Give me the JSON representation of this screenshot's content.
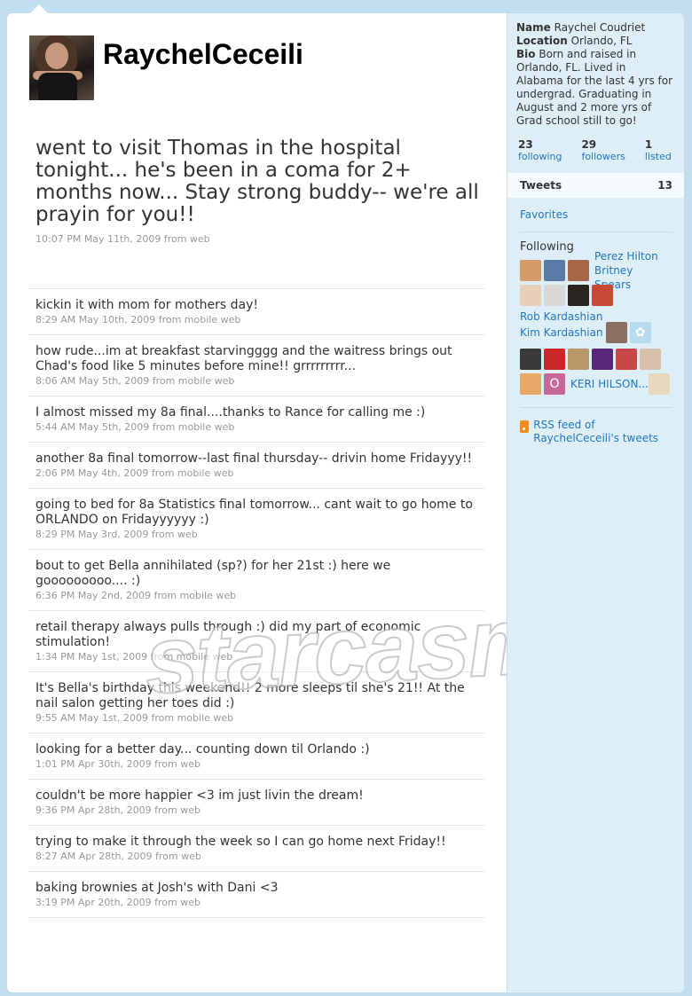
{
  "profile": {
    "username": "RaychelCeceili",
    "name_label": "Name",
    "name": "Raychel Coudriet",
    "location_label": "Location",
    "location": "Orlando, FL",
    "bio_label": "Bio",
    "bio": "Born and raised in Orlando, FL. Lived in Alabama for the last 4 yrs for undergrad. Graduating in August and 2 more yrs of Grad school still to go!"
  },
  "stats": [
    {
      "num": "23",
      "label": "following"
    },
    {
      "num": "29",
      "label": "followers"
    },
    {
      "num": "1",
      "label": "listed"
    }
  ],
  "sidebar": {
    "tweets_label": "Tweets",
    "tweets_count": "13",
    "favorites_label": "Favorites",
    "following_heading": "Following",
    "following_names": {
      "perez": "Perez Hilton",
      "britney": "Britney Spears",
      "rob": "Rob Kardashian",
      "kim": "Kim Kardashian",
      "keri": "KERI HILSON..."
    },
    "rss_label": "RSS feed of RaychelCeceili's tweets"
  },
  "featured": {
    "text": "went to visit Thomas in the hospital tonight... he's been in a coma for 2+ months now... Stay strong buddy-- we're all prayin for you!!",
    "meta": "10:07 PM May 11th, 2009 from web"
  },
  "tweets": [
    {
      "text": "kickin it with mom for mothers day!",
      "meta": "8:29 AM May 10th, 2009 from mobile web"
    },
    {
      "text": "how rude...im at breakfast starvingggg and the waitress brings out Chad's food like 5 minutes before mine!! grrrrrrrrr...",
      "meta": "8:06 AM May 5th, 2009 from mobile web"
    },
    {
      "text": "I almost missed my 8a final....thanks to Rance for calling me :)",
      "meta": "5:44 AM May 5th, 2009 from mobile web"
    },
    {
      "text": "another 8a final tomorrow--last final thursday-- drivin home Fridayyy!!",
      "meta": "2:06 PM May 4th, 2009 from mobile web"
    },
    {
      "text": "going to bed for 8a Statistics final tomorrow... cant wait to go home to ORLANDO on Fridayyyyyy :)",
      "meta": "8:29 PM May 3rd, 2009 from web"
    },
    {
      "text": "bout to get Bella annihilated (sp?) for her 21st :) here we gooooooooo.... :)",
      "meta": "6:36 PM May 2nd, 2009 from mobile web"
    },
    {
      "text": "retail therapy always pulls through :) did my part of economic stimulation!",
      "meta": "1:34 PM May 1st, 2009 from mobile web"
    },
    {
      "text": "It's Bella's birthday this weekend!! 2 more sleeps til she's 21!! At the nail salon getting her toes did :)",
      "meta": "9:55 AM May 1st, 2009 from mobile web"
    },
    {
      "text": "looking for a better day... counting down til Orlando :)",
      "meta": "1:01 PM Apr 30th, 2009 from web"
    },
    {
      "text": "couldn't be more happier <3 im just livin the dream!",
      "meta": "9:36 PM Apr 28th, 2009 from web"
    },
    {
      "text": "trying to make it through the week so I can go home next Friday!!",
      "meta": "8:27 AM Apr 28th, 2009 from web"
    },
    {
      "text": "baking brownies at Josh's with Dani <3",
      "meta": "3:19 PM Apr 20th, 2009 from web"
    }
  ],
  "watermark": "starcasm.net",
  "colors": {
    "background": "#c0deed",
    "link": "#2276bb",
    "sidebar": "#ddeef6"
  }
}
